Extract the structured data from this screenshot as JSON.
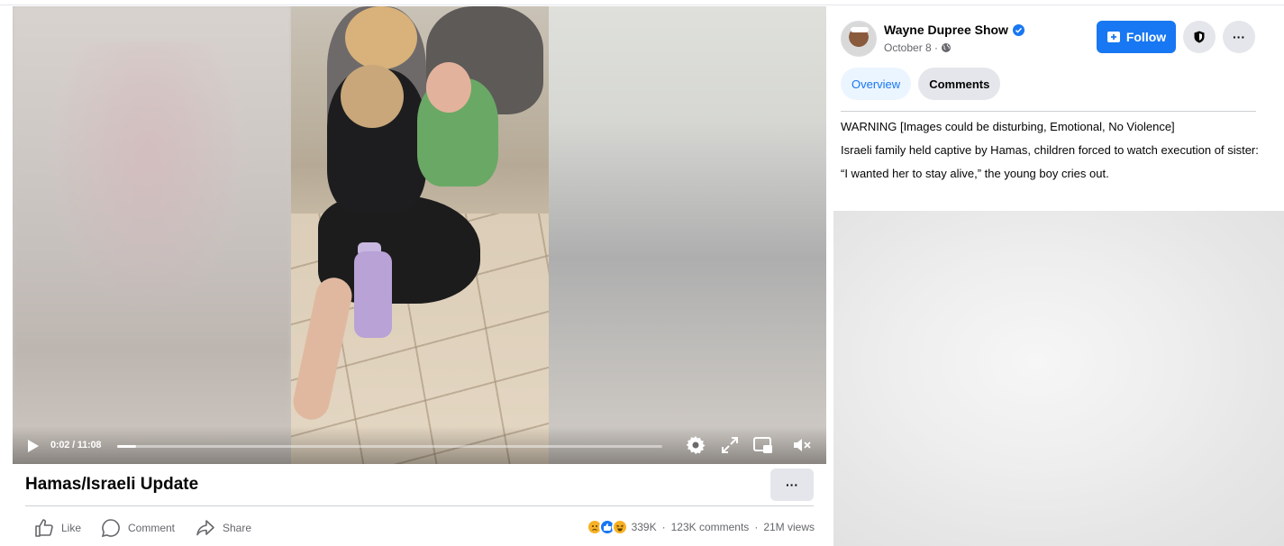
{
  "video": {
    "time_label": "0:02 / 11:08",
    "progress_fraction": 0.004
  },
  "post": {
    "title": "Hamas/Israeli Update",
    "more_label": "···",
    "actions": {
      "like": "Like",
      "comment": "Comment",
      "share": "Share"
    },
    "stats": {
      "reactions": "339K",
      "comments": "123K comments",
      "views": "21M views",
      "separator": "·"
    }
  },
  "page": {
    "name": "Wayne Dupree Show",
    "date": "October 8 ·",
    "follow_label": "Follow",
    "more_label": "···"
  },
  "tabs": [
    {
      "label": "Overview"
    },
    {
      "label": "Comments"
    }
  ],
  "description": {
    "line1": "WARNING [Images could be disturbing, Emotional, No Violence]",
    "line2": "Israeli family held captive by Hamas, children forced to watch execution of sister:",
    "line3": "“I wanted her to stay alive,” the young boy cries out."
  },
  "colors": {
    "accent": "#1877f2",
    "secondary_text": "#65676b",
    "button_gray": "#e4e6eb"
  },
  "icons": [
    "play-icon",
    "settings-icon",
    "fullscreen-icon",
    "pip-icon",
    "mute-icon",
    "like-icon",
    "comment-icon",
    "share-icon",
    "verified-icon",
    "globe-icon",
    "follow-plus-icon",
    "shield-icon",
    "more-icon"
  ]
}
